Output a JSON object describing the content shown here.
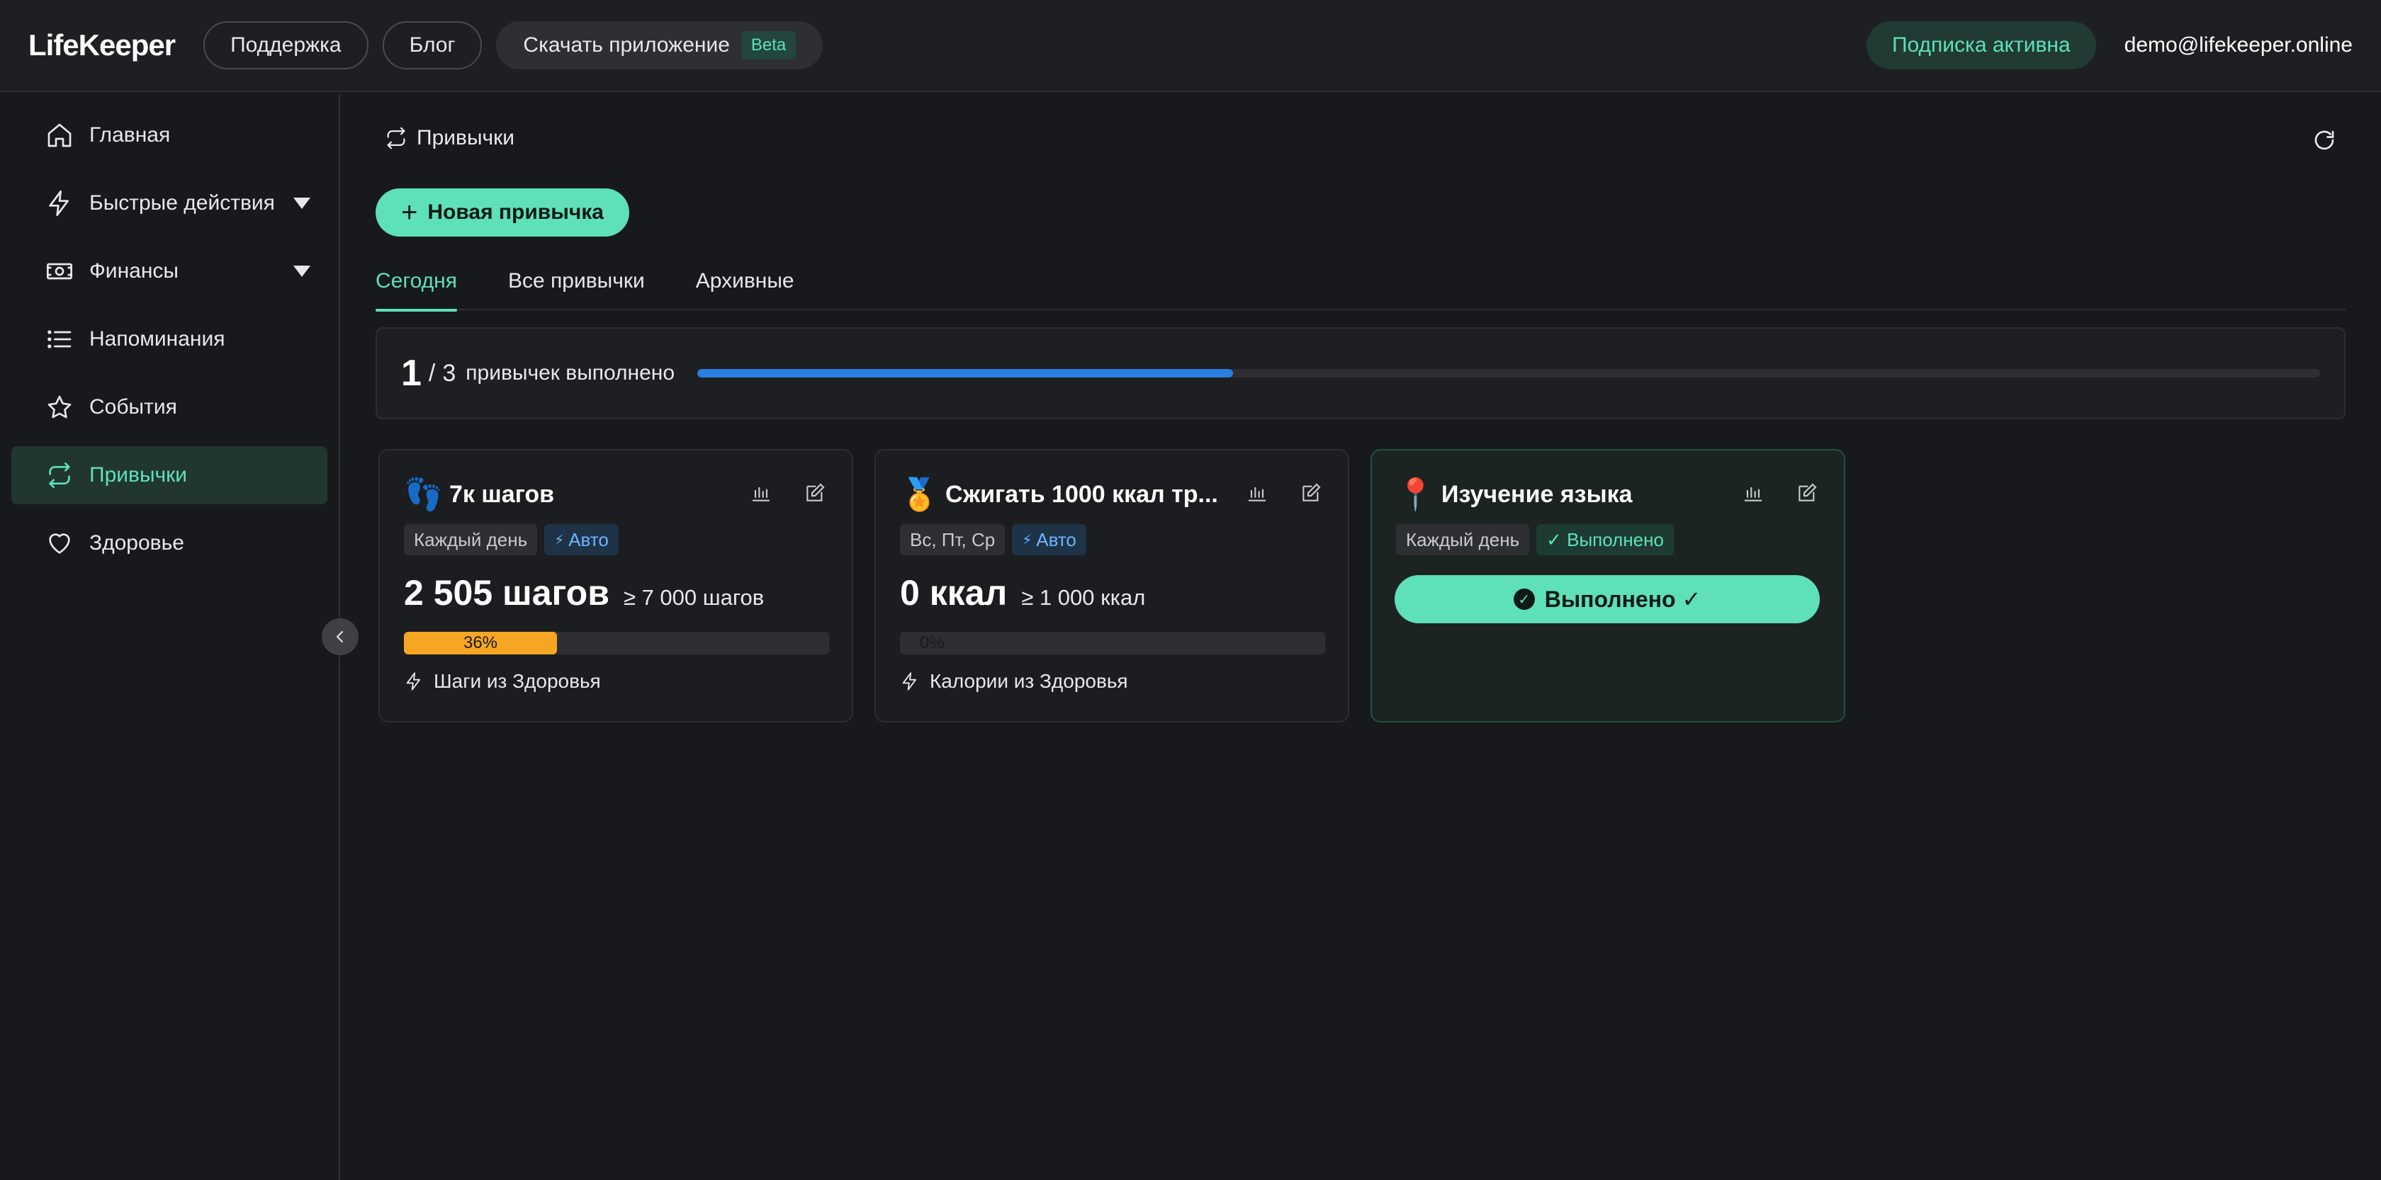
{
  "header": {
    "logo": "LifeKeeper",
    "support_label": "Поддержка",
    "blog_label": "Блог",
    "download_label": "Скачать приложение",
    "beta_badge": "Beta",
    "subscription_label": "Подписка активна",
    "user_email": "demo@lifekeeper.online"
  },
  "sidebar": {
    "items": [
      {
        "label": "Главная",
        "icon": "home-icon"
      },
      {
        "label": "Быстрые действия",
        "icon": "lightning-icon"
      },
      {
        "label": "Финансы",
        "icon": "money-icon"
      },
      {
        "label": "Напоминания",
        "icon": "list-icon"
      },
      {
        "label": "События",
        "icon": "star-icon"
      },
      {
        "label": "Привычки",
        "icon": "repeat-icon",
        "active": true
      },
      {
        "label": "Здоровье",
        "icon": "heart-icon"
      }
    ]
  },
  "main": {
    "section_title": "Привычки",
    "new_habit_label": "Новая привычка",
    "tabs": [
      {
        "label": "Сегодня",
        "active": true
      },
      {
        "label": "Все привычки"
      },
      {
        "label": "Архивные"
      }
    ],
    "summary": {
      "done": "1",
      "total": "3",
      "label": "привычек выполнено",
      "progress": 0.33
    },
    "habits": [
      {
        "emoji": "👣",
        "title": "7к шагов",
        "frequency": "Каждый день",
        "auto_tag": "Авто",
        "value": "2 505 шагов",
        "goal": "≥  7 000 шагов",
        "progress": 0.36,
        "progress_label": "36%",
        "source": "Шаги из Здоровья"
      },
      {
        "emoji": "🏅",
        "title": "Сжигать 1000 ккал тр...",
        "frequency": "Вс, Пт, Ср",
        "auto_tag": "Авто",
        "value": "0 ккал",
        "goal": "≥  1 000 ккал",
        "progress": 0,
        "progress_label": "0%",
        "source": "Калории из Здоровья"
      },
      {
        "emoji": "📍",
        "title": "Изучение языка",
        "frequency": "Каждый день",
        "status_tag": "✓ Выполнено",
        "done_button": "Выполнено ✓"
      }
    ]
  },
  "colors": {
    "accent": "#5ee0b8",
    "progress_blue": "#2a7fe0",
    "progress_orange": "#f5a623",
    "background": "#18191c"
  }
}
